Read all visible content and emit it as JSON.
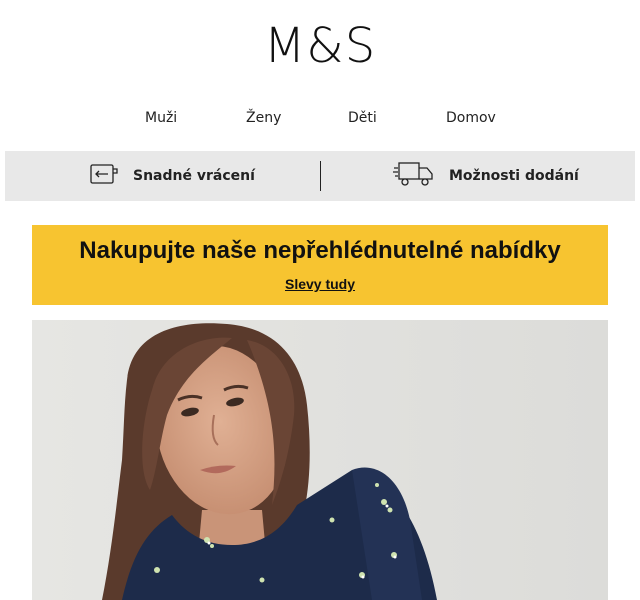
{
  "header": {
    "logo": "M&S"
  },
  "nav": {
    "items": [
      {
        "label": "Muži"
      },
      {
        "label": "Ženy"
      },
      {
        "label": "Děti"
      },
      {
        "label": "Domov"
      }
    ]
  },
  "services": {
    "returns": {
      "label": "Snadné vrácení",
      "icon": "return-box-icon"
    },
    "delivery": {
      "label": "Možnosti dodání",
      "icon": "delivery-truck-icon"
    }
  },
  "promo": {
    "title": "Nakupujte naše nepřehlédnutelné nabídky",
    "link": "Slevy tudy",
    "background": "#f7c430"
  },
  "hero": {
    "image": "woman-floral-dress-photo"
  }
}
